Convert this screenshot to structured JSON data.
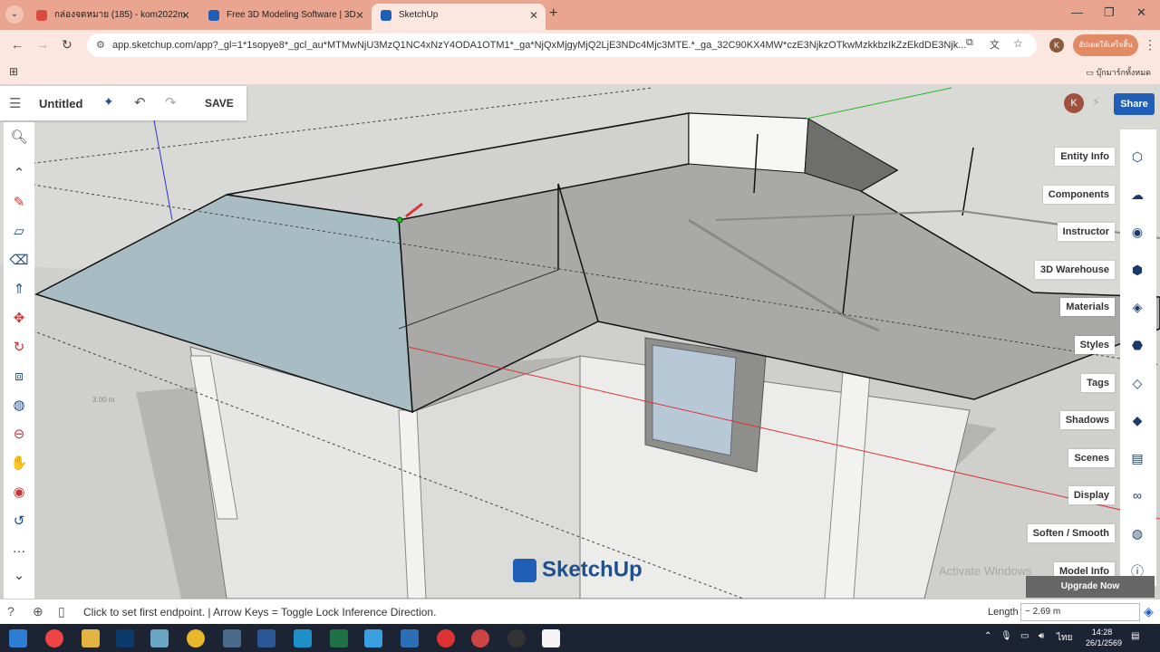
{
  "browser": {
    "tabs": [
      {
        "label": "กล่องจดหมาย (185) - kom2022m",
        "icon": "gmail-icon",
        "color": "#d94c3d"
      },
      {
        "label": "Free 3D Modeling Software | 3D",
        "icon": "sketchup-icon",
        "color": "#1f5fb8"
      },
      {
        "label": "SketchUp",
        "icon": "sketchup-icon",
        "color": "#1f5fb8"
      }
    ],
    "url": "app.sketchup.com/app?_gl=1*1sopye8*_gcl_au*MTMwNjU3MzQ1NC4xNzY4ODA1OTM1*_ga*NjQxMjgyMjQ2LjE3NDc4Mjc3MTE.*_ga_32C90KX4MW*czE3NjkzOTkwMzkkbzIkZzEkdDE3Njk...",
    "update_button": "อัปเดตให้เสร็จสิ้น",
    "profile_initial": "K",
    "bookmark_folder": "บุ๊กมาร์กทั้งหมด"
  },
  "app": {
    "title": "Untitled",
    "save_label": "SAVE",
    "share_label": "Share",
    "user_initial": "K",
    "brand": "SketchUp",
    "accent": "#1f5fb8"
  },
  "panels": [
    {
      "label": "Entity Info",
      "icon": "entity-info-icon"
    },
    {
      "label": "Components",
      "icon": "components-icon"
    },
    {
      "label": "Instructor",
      "icon": "instructor-icon"
    },
    {
      "label": "3D Warehouse",
      "icon": "warehouse-icon"
    },
    {
      "label": "Materials",
      "icon": "materials-icon"
    },
    {
      "label": "Styles",
      "icon": "styles-icon"
    },
    {
      "label": "Tags",
      "icon": "tags-icon"
    },
    {
      "label": "Shadows",
      "icon": "shadows-icon"
    },
    {
      "label": "Scenes",
      "icon": "scenes-icon"
    },
    {
      "label": "Display",
      "icon": "display-icon"
    },
    {
      "label": "Soften / Smooth",
      "icon": "soften-icon"
    },
    {
      "label": "Model Info",
      "icon": "model-info-icon"
    }
  ],
  "viewport": {
    "dimension_text": "3.00 m",
    "activate_text": "Activate Windows",
    "upgrade_label": "Upgrade Now"
  },
  "status": {
    "message": "Click to set first endpoint. | Arrow Keys = Toggle Lock Inference Direction.",
    "length_label": "Length",
    "length_value": "~ 2.69 m"
  },
  "taskbar": {
    "tray_lang": "ไทย",
    "time": "14:28",
    "date": "26/1/2569"
  }
}
